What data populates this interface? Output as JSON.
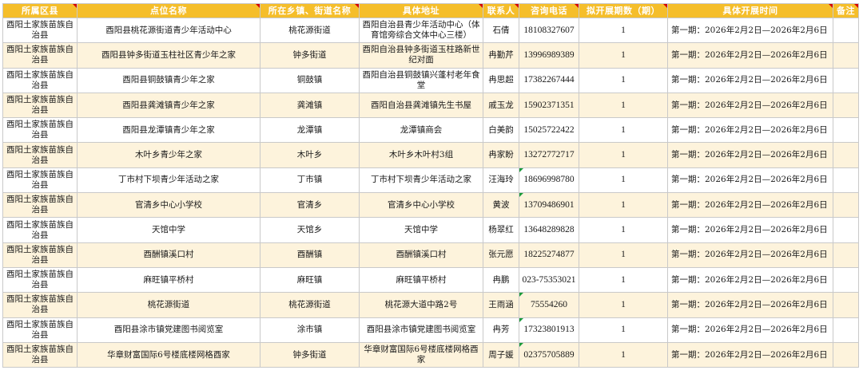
{
  "headers": [
    "所属区县",
    "点位名称",
    "所在乡镇、街道名称",
    "具体地址",
    "联系人",
    "咨询电话",
    "拟开展期数（期）",
    "具体开展时间",
    "备注"
  ],
  "rows": [
    {
      "county": "酉阳土家族苗族自治县",
      "name": "酉阳县桃花源街道青少年活动中心",
      "town": "桃花源街道",
      "address": "酉阳自治县青少年活动中心（体育馆旁综合文体中心三楼）",
      "contact": "石倩",
      "phone": "18108327607",
      "periods": "1",
      "time": "第一期：2026年2月2日—2026年2月6日",
      "note": ""
    },
    {
      "county": "酉阳土家族苗族自治县",
      "name": "酉阳县钟多街道玉柱社区青少年之家",
      "town": "钟多街道",
      "address": "酉阳自治县钟多街道玉柱路新世纪对面",
      "contact": "冉勤芹",
      "phone": "13996989389",
      "periods": "1",
      "time": "第一期：2026年2月2日—2026年2月6日",
      "note": ""
    },
    {
      "county": "酉阳土家族苗族自治县",
      "name": "酉阳县铜鼓镇青少年之家",
      "town": "铜鼓镇",
      "address": "酉阳自治县铜鼓镇兴蓬村老年食堂",
      "contact": "冉思超",
      "phone": "17382267444",
      "periods": "1",
      "time": "第一期：2026年2月2日—2026年2月6日",
      "note": ""
    },
    {
      "county": "酉阳土家族苗族自治县",
      "name": "酉阳县龚滩镇青少年之家",
      "town": "龚滩镇",
      "address": "酉阳自治县龚滩镇先生书屋",
      "contact": "戚玉龙",
      "phone": "15902371351",
      "periods": "1",
      "time": "第一期：2026年2月2日—2026年2月6日",
      "note": ""
    },
    {
      "county": "酉阳土家族苗族自治县",
      "name": "酉阳县龙潭镇青少年之家",
      "town": "龙潭镇",
      "address": "龙潭镇商会",
      "contact": "白美韵",
      "phone": "15025722422",
      "periods": "1",
      "time": "第一期：2026年2月2日—2026年2月6日",
      "note": ""
    },
    {
      "county": "酉阳土家族苗族自治县",
      "name": "木叶乡青少年之家",
      "town": "木叶乡",
      "address": "木叶乡木叶村3组",
      "contact": "冉家盼",
      "phone": "13272772717",
      "periods": "1",
      "time": "第一期：2026年2月2日—2026年2月6日",
      "note": ""
    },
    {
      "county": "酉阳土家族苗族自治县",
      "name": "丁市村下坝青少年活动之家",
      "town": "丁市镇",
      "address": "丁市村下坝青少年活动之家",
      "contact": "汪海玲",
      "phone": "18696998780",
      "periods": "1",
      "time": "第一期：2026年2月2日—2026年2月6日",
      "note": ""
    },
    {
      "county": "酉阳土家族苗族自治县",
      "name": "官清乡中心小学校",
      "town": "官清乡",
      "address": "官清乡中心小学校",
      "contact": "黄波",
      "phone": "13709486901",
      "periods": "1",
      "time": "第一期：2026年2月2日—2026年2月6日",
      "note": ""
    },
    {
      "county": "酉阳土家族苗族自治县",
      "name": "天馆中学",
      "town": "天馆乡",
      "address": "天馆中学",
      "contact": "杨翠红",
      "phone": "13648289828",
      "periods": "1",
      "time": "第一期：2026年2月2日—2026年2月6日",
      "note": ""
    },
    {
      "county": "酉阳土家族苗族自治县",
      "name": "酉酬镇溪口村",
      "town": "酉酬镇",
      "address": "酉酬镇溪口村",
      "contact": "张元愿",
      "phone": "18225274877",
      "periods": "1",
      "time": "第一期：2026年2月2日—2026年2月6日",
      "note": ""
    },
    {
      "county": "酉阳土家族苗族自治县",
      "name": "麻旺镇平桥村",
      "town": "麻旺镇",
      "address": "麻旺镇平桥村",
      "contact": "冉鹏",
      "phone": "023-75353021",
      "periods": "1",
      "time": "第一期：2026年2月2日—2026年2月6日",
      "note": ""
    },
    {
      "county": "酉阳土家族苗族自治县",
      "name": "桃花源街道",
      "town": "桃花源街道",
      "address": "桃花源大道中路2号",
      "contact": "王雨涵",
      "phone": "75554260",
      "periods": "1",
      "time": "第一期：2026年2月2日—2026年2月6日",
      "note": ""
    },
    {
      "county": "酉阳土家族苗族自治县",
      "name": "酉阳县涂市镇党建图书阅览室",
      "town": "涂市镇",
      "address": "酉阳县涂市镇党建图书阅览室",
      "contact": "冉芳",
      "phone": "17323801913",
      "periods": "1",
      "time": "第一期：2026年2月2日—2026年2月6日",
      "note": ""
    },
    {
      "county": "酉阳土家族苗族自治县",
      "name": "华章财富国际6号楼底楼网格酉家",
      "town": "钟多街道",
      "address": "华章财富国际6号楼底楼网格酉家",
      "contact": "周子媛",
      "phone": "02375705889",
      "periods": "1",
      "time": "第一期：2026年2月2日—2026年2月6日",
      "note": ""
    }
  ]
}
